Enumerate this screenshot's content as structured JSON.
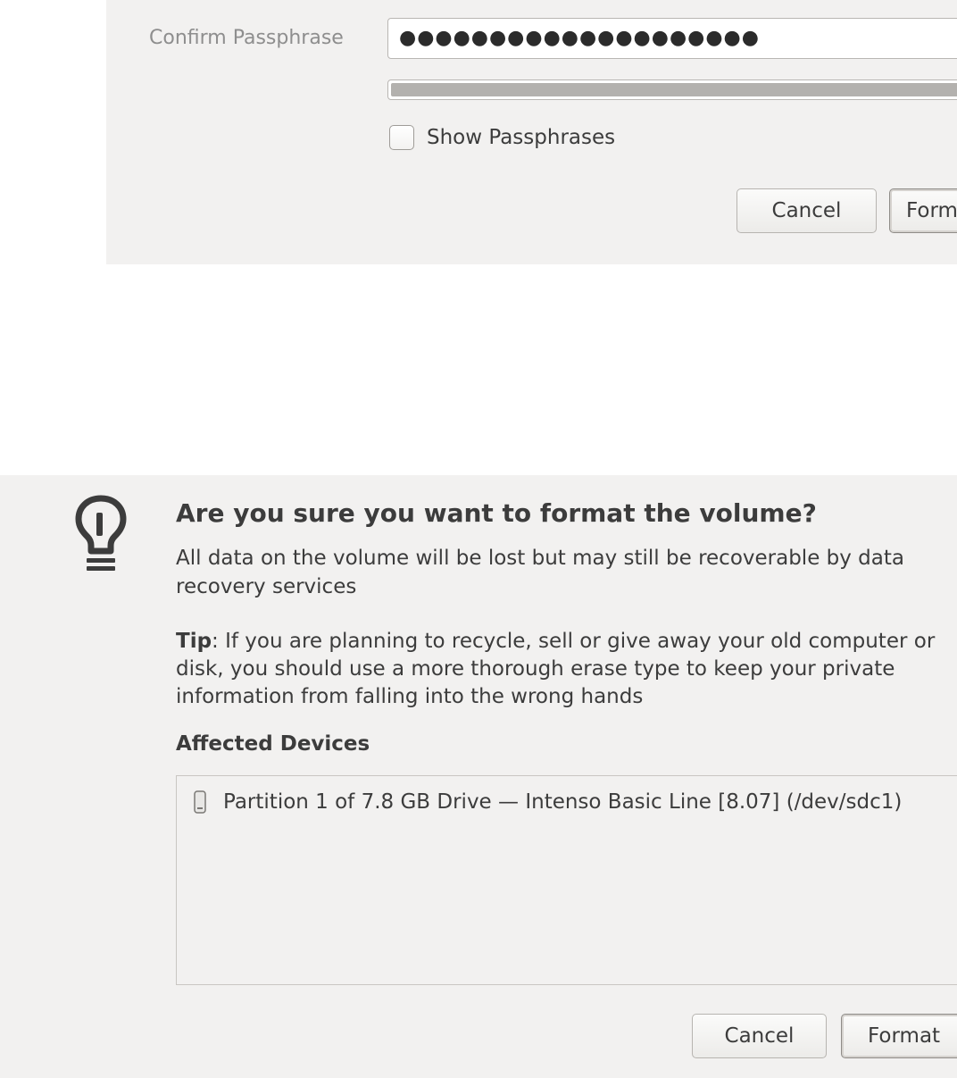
{
  "format_dialog": {
    "confirm_passphrase_label": "Confirm Passphrase",
    "confirm_passphrase_value": "●●●●●●●●●●●●●●●●●●●●",
    "strength_level": 1.0,
    "show_passphrases_label": "Show Passphrases",
    "show_passphrases_checked": false,
    "cancel_label": "Cancel",
    "format_label": "Form"
  },
  "confirm_dialog": {
    "icon": "lightbulb-icon",
    "heading": "Are you sure you want to format the volume?",
    "message": "All data on the volume will be lost but may still be recoverable by data recovery services",
    "tip_label": "Tip",
    "tip_text": ": If you are planning to recycle, sell or give away your old computer or disk, you should use a more thorough erase type to keep your private information from falling into the wrong hands",
    "affected_devices_label": "Affected Devices",
    "devices": [
      {
        "icon": "drive-icon",
        "label": "Partition 1 of 7.8 GB Drive — Intenso Basic Line [8.07] (/dev/sdc1)"
      }
    ],
    "cancel_label": "Cancel",
    "format_label": "Format"
  },
  "colors": {
    "dialog_bg": "#f2f1f0",
    "text": "#3c3c3c",
    "label_muted": "#8e8e8e",
    "border": "#b9b6b3",
    "strength_fill": "#b3b1ae"
  }
}
